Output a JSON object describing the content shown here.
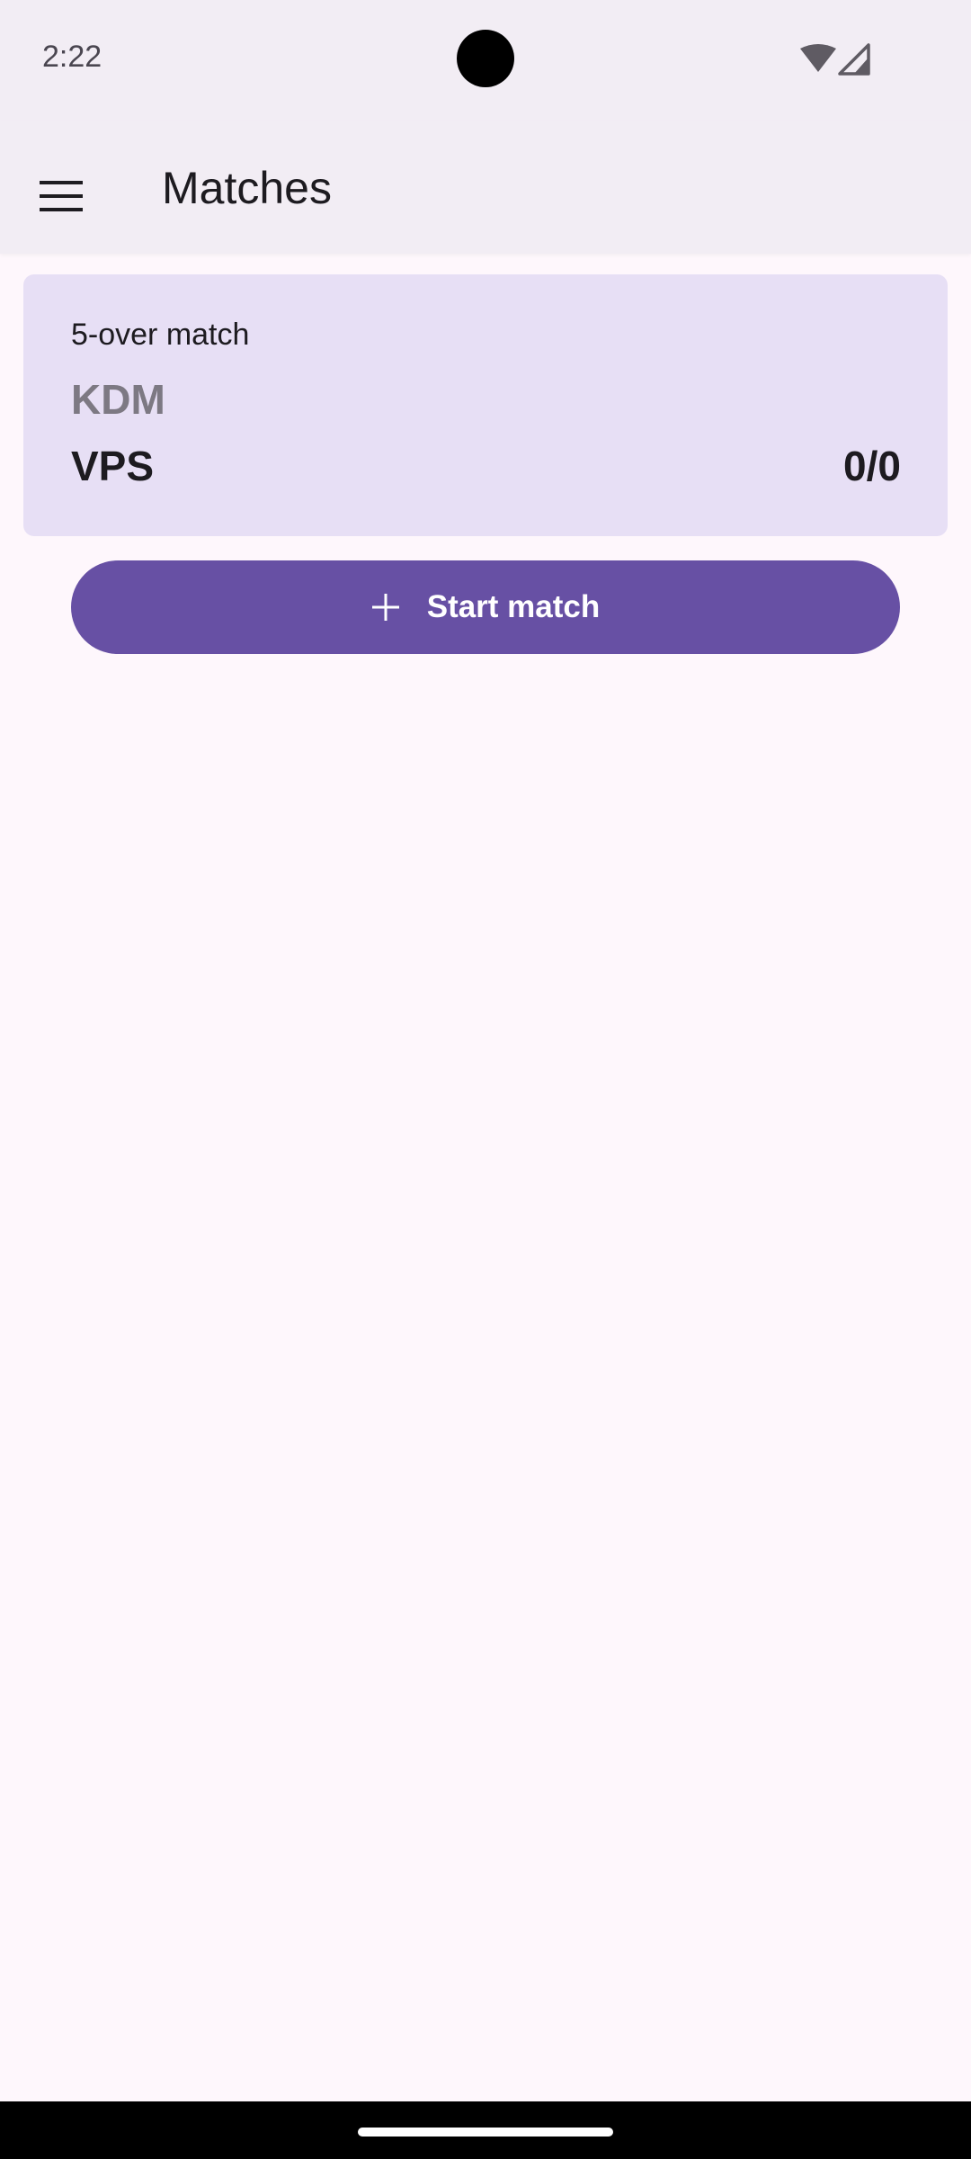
{
  "status_bar": {
    "time": "2:22",
    "icons": [
      "wifi-icon",
      "cellular-signal-icon"
    ]
  },
  "app_bar": {
    "title": "Matches",
    "menu_icon": "menu-icon"
  },
  "match_card": {
    "match_type": "5-over match",
    "team_a": {
      "name": "KDM"
    },
    "team_b": {
      "name": "VPS",
      "score": "0/0"
    }
  },
  "start_button": {
    "label": "Start match",
    "icon": "plus-icon"
  },
  "colors": {
    "primary": "#6750A4",
    "card_background": "#E7DFF5",
    "surface": "#FEF7FC",
    "app_bar": "#F2EDF4",
    "inactive_team": "#7D7983"
  }
}
